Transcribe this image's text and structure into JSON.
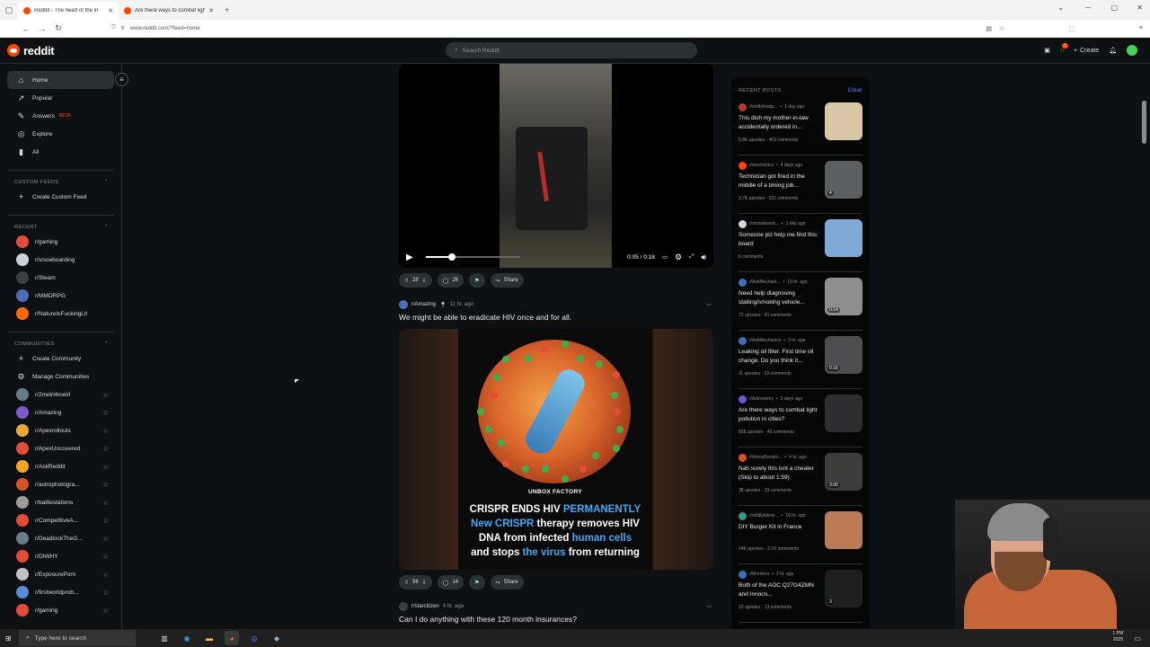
{
  "browser": {
    "tabs": [
      {
        "title": "Reddit - The heart of the in",
        "active": true
      },
      {
        "title": "Are there ways to combat light",
        "active": false
      }
    ],
    "url": "www.reddit.com/?feed=home"
  },
  "header": {
    "logo_text": "reddit",
    "search_placeholder": "Search Reddit",
    "create_label": "Create",
    "chat_badge": "1"
  },
  "sidebar": {
    "main_items": [
      {
        "label": "Home",
        "icon": "home-icon"
      },
      {
        "label": "Popular",
        "icon": "trending-icon"
      },
      {
        "label": "Answers",
        "icon": "answers-icon",
        "badge": "BETA"
      },
      {
        "label": "Explore",
        "icon": "explore-icon"
      },
      {
        "label": "All",
        "icon": "all-icon"
      }
    ],
    "custom_feeds_heading": "CUSTOM FEEDS",
    "create_custom_feed": "Create Custom Feed",
    "recent_heading": "RECENT",
    "recent": [
      "r/gaming",
      "r/snowboarding",
      "r/Steam",
      "r/MMORPG",
      "r/NatureIsFuckingLit"
    ],
    "communities_heading": "COMMUNITIES",
    "create_community": "Create Community",
    "manage_communities": "Manage Communities",
    "communities": [
      "r/2meirl4meirl",
      "r/Amazing",
      "r/Apexrollouts",
      "r/ApexUncovered",
      "r/AskReddit",
      "r/astrophotogra...",
      "r/battlestations",
      "r/CompetitiveA...",
      "r/DeadlockTheG...",
      "r/DIWHY",
      "r/ExposurePorn",
      "r/firstworldprob...",
      "r/gaming"
    ]
  },
  "feed": {
    "post1": {
      "video_time": "0:05 / 0:18",
      "video_progress": 0.28,
      "upvotes": "28",
      "comments": "26",
      "share": "Share"
    },
    "post2": {
      "subreddit": "r/Amazing",
      "age": "11 hr. ago",
      "title": "We might be able to eradicate HIV once and for all.",
      "image_brand": "UNBOX FACTORY",
      "image_lines": [
        {
          "parts": [
            {
              "t": "CRISPR ENDS HIV ",
              "hl": false
            },
            {
              "t": "PERMANENTLY",
              "hl": true
            }
          ]
        },
        {
          "parts": [
            {
              "t": "New CRISPR",
              "hl": true
            },
            {
              "t": " therapy removes HIV",
              "hl": false
            }
          ]
        },
        {
          "parts": [
            {
              "t": "DNA from infected ",
              "hl": false
            },
            {
              "t": "human cells",
              "hl": true
            }
          ]
        },
        {
          "parts": [
            {
              "t": "and stops ",
              "hl": false
            },
            {
              "t": "the virus",
              "hl": true
            },
            {
              "t": " from returning",
              "hl": false
            }
          ]
        }
      ],
      "upvotes": "98",
      "comments": "14",
      "share": "Share"
    },
    "post3": {
      "subreddit": "r/starcitizen",
      "age": "4 hr. ago",
      "title": "Can I do anything with these 120 month insurances?"
    }
  },
  "recent_posts": {
    "heading": "RECENT POSTS",
    "clear": "Clear",
    "items": [
      {
        "sub": "r/shittyfoodp...",
        "age": "1 day ago",
        "title": "This dish my mother-in-law accidentally ordered in...",
        "stats": "5.6K upvotes · 403 comments",
        "icon_color": "#b33a2a",
        "thumb": "#d9c7a8",
        "badge": ""
      },
      {
        "sub": "r/mechanics",
        "age": "4 days ago",
        "title": "Technician got fired in the middle of a timing job...",
        "stats": "3.7K upvotes · 531 comments",
        "icon_color": "#ff4500",
        "thumb": "#5b5f62",
        "badge": "4"
      },
      {
        "sub": "r/snowboardi...",
        "age": "1 day ago",
        "title": "Someone plz help me find this board",
        "stats": "6 comments",
        "icon_color": "#cfd6dc",
        "thumb": "#7fa9d6",
        "badge": ""
      },
      {
        "sub": "r/AskMechani...",
        "age": "13 hr. ago",
        "title": "Need help diagnosing stalling/smoking vehicle...",
        "stats": "72 upvotes · 41 comments",
        "icon_color": "#3d6fb8",
        "thumb": "#8d8f8e",
        "badge": "0:14"
      },
      {
        "sub": "r/AskMechanics",
        "age": "3 hr. ago",
        "title": "Leaking oil filter. First time oil change. Do you think it...",
        "stats": "11 upvotes · 33 comments",
        "icon_color": "#3d6fb8",
        "thumb": "#4b4d4f",
        "badge": "0:16"
      },
      {
        "sub": "r/Astronomy",
        "age": "3 days ago",
        "title": "Are there ways to combat light pollution in cities?",
        "stats": "838 upvotes · 49 comments",
        "icon_color": "#6a5acd",
        "thumb": "#2c2e30",
        "badge": ""
      },
      {
        "sub": "r/ArenaBreako...",
        "age": "4 hr. ago",
        "title": "Nah surely this isnt a cheater (Skip to about 1:59)",
        "stats": "38 upvotes · 33 comments",
        "icon_color": "#d9532a",
        "thumb": "#3b3d3a",
        "badge": "3:00"
      },
      {
        "sub": "r/mildlyintere...",
        "age": "16 hr. ago",
        "title": "DIY Burger Kit in France",
        "stats": "24K upvotes · 2.1K comments",
        "icon_color": "#2e9c8c",
        "thumb": "#b97a55",
        "badge": ""
      },
      {
        "sub": "r/Monitors",
        "age": "2 hr. ago",
        "title": "Both of the AOC Q27G4ZMN and Innocn...",
        "stats": "10 upvotes · 13 comments",
        "icon_color": "#3d6fb8",
        "thumb": "#1f1f1f",
        "badge": "3"
      }
    ]
  },
  "taskbar": {
    "search_placeholder": "Type here to search",
    "clock_time": "1 PM",
    "clock_date": "2025"
  }
}
